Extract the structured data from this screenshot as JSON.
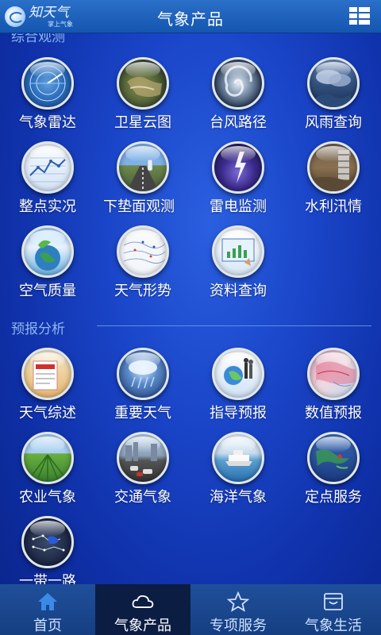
{
  "header": {
    "title": "气象产品",
    "logo_text": "知天气",
    "logo_sub": "掌上气象"
  },
  "sections": [
    {
      "title": "综合观测",
      "items": [
        {
          "label": "气象雷达",
          "icon": "radar-icon"
        },
        {
          "label": "卫星云图",
          "icon": "satellite-map-icon"
        },
        {
          "label": "台风路径",
          "icon": "typhoon-icon"
        },
        {
          "label": "风雨查询",
          "icon": "storm-icon"
        },
        {
          "label": "整点实况",
          "icon": "line-chart-icon"
        },
        {
          "label": "下垫面观测",
          "icon": "road-icon"
        },
        {
          "label": "雷电监测",
          "icon": "lightning-icon"
        },
        {
          "label": "水利汛情",
          "icon": "flood-icon"
        },
        {
          "label": "空气质量",
          "icon": "earth-icon"
        },
        {
          "label": "天气形势",
          "icon": "weather-map-icon"
        },
        {
          "label": "资料查询",
          "icon": "data-query-icon"
        }
      ]
    },
    {
      "title": "预报分析",
      "items": [
        {
          "label": "天气综述",
          "icon": "newspaper-icon"
        },
        {
          "label": "重要天气",
          "icon": "heavy-weather-icon"
        },
        {
          "label": "指导预报",
          "icon": "guidance-icon"
        },
        {
          "label": "数值预报",
          "icon": "numerical-map-icon"
        },
        {
          "label": "农业气象",
          "icon": "farmland-icon"
        },
        {
          "label": "交通气象",
          "icon": "traffic-icon"
        },
        {
          "label": "海洋气象",
          "icon": "ocean-icon"
        },
        {
          "label": "定点服务",
          "icon": "point-map-icon"
        },
        {
          "label": "一带一路",
          "icon": "belt-road-icon"
        }
      ]
    }
  ],
  "bottom_nav": [
    {
      "label": "首页",
      "icon": "home-icon"
    },
    {
      "label": "气象产品",
      "icon": "cloud-icon",
      "active": true
    },
    {
      "label": "专项服务",
      "icon": "star-icon"
    },
    {
      "label": "气象生活",
      "icon": "calendar-icon"
    }
  ]
}
